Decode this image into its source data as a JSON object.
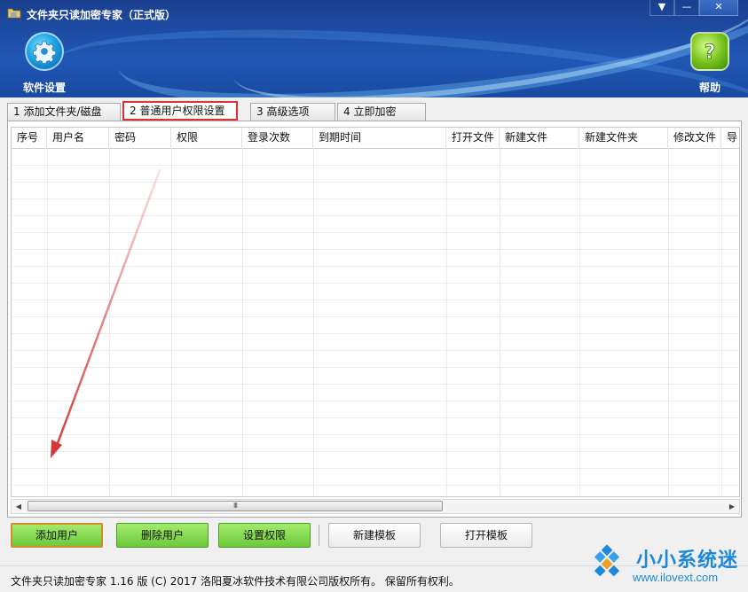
{
  "window": {
    "title": "文件夹只读加密专家（正式版）",
    "controls": {
      "dropdown": "▼",
      "minimize": "—",
      "close": "✕"
    }
  },
  "toolbar": {
    "settings_label": "软件设置",
    "help_label": "帮助"
  },
  "tabs": [
    {
      "label": "1 添加文件夹/磁盘"
    },
    {
      "label": "2 普通用户权限设置",
      "active": true
    },
    {
      "label": "3 高级选项"
    },
    {
      "label": "4 立即加密"
    }
  ],
  "table": {
    "columns": [
      "序号",
      "用户名",
      "密码",
      "权限",
      "登录次数",
      "到期时间",
      "打开文件",
      "新建文件",
      "新建文件夹",
      "修改文件",
      "导"
    ],
    "rows": []
  },
  "scrollbar": {
    "left_arrow": "◀",
    "right_arrow": "▶",
    "grip": "III"
  },
  "buttons": {
    "add_user": "添加用户",
    "delete_user": "删除用户",
    "set_permission": "设置权限",
    "new_template": "新建模板",
    "open_template": "打开模板"
  },
  "status": {
    "text": "文件夹只读加密专家 1.16 版  (C)  2017 洛阳夏冰软件技术有限公司版权所有。 保留所有权利。"
  },
  "watermark": {
    "site_name": "小小系统迷",
    "url": "www.ilovext.com"
  },
  "colors": {
    "header_blue": "#1e4da6",
    "active_tab_highlight": "#e03030",
    "green_button": "#6cc83a",
    "annotation_arrow": "#d23a3a",
    "watermark_blue": "#1e88d8"
  },
  "icons": {
    "settings": "gear-icon",
    "help": "question-icon",
    "app": "app-icon"
  }
}
